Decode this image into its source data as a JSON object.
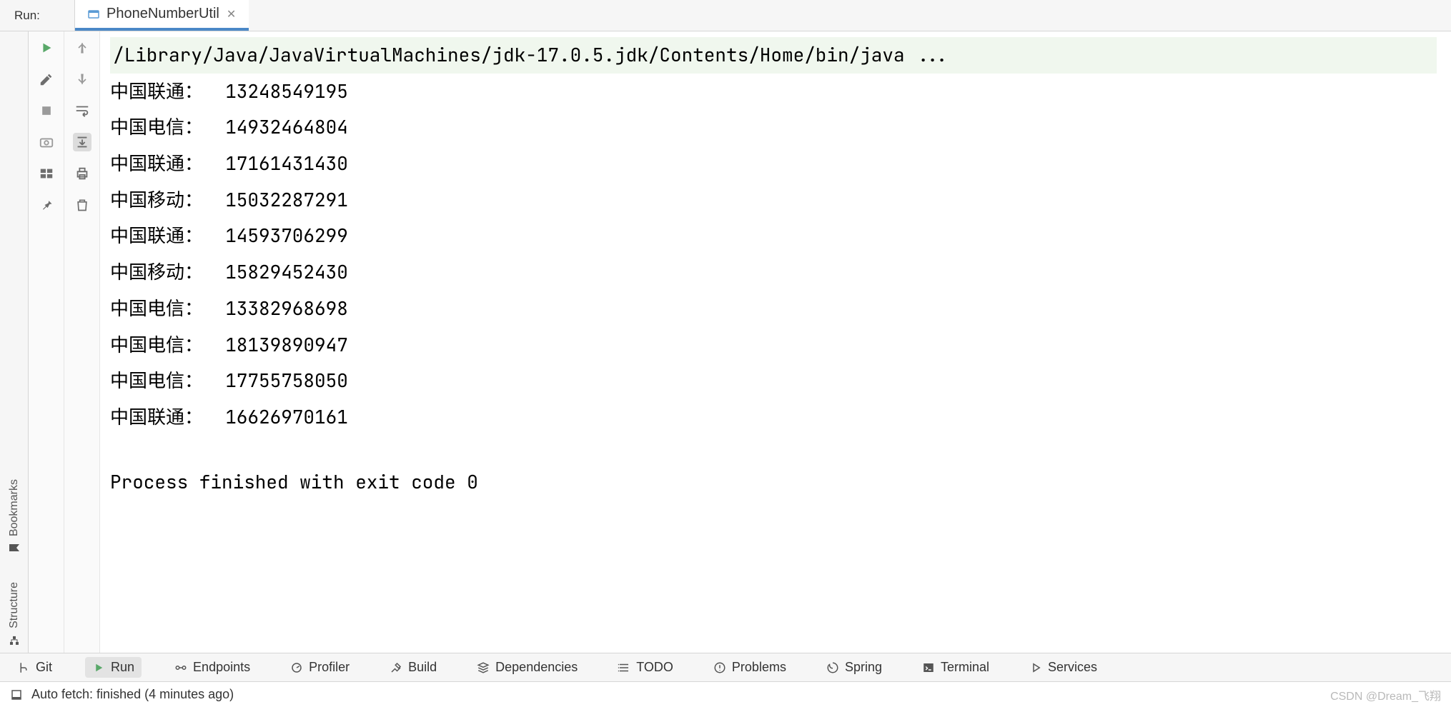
{
  "header": {
    "run_label": "Run:",
    "tab_title": "PhoneNumberUtil"
  },
  "left_rail": {
    "bookmarks_label": "Bookmarks",
    "structure_label": "Structure"
  },
  "console": {
    "command_line": "/Library/Java/JavaVirtualMachines/jdk-17.0.5.jdk/Contents/Home/bin/java ...",
    "lines": [
      {
        "carrier": "中国联通",
        "number": "13248549195"
      },
      {
        "carrier": "中国电信",
        "number": "14932464804"
      },
      {
        "carrier": "中国联通",
        "number": "17161431430"
      },
      {
        "carrier": "中国移动",
        "number": "15032287291"
      },
      {
        "carrier": "中国联通",
        "number": "14593706299"
      },
      {
        "carrier": "中国移动",
        "number": "15829452430"
      },
      {
        "carrier": "中国电信",
        "number": "13382968698"
      },
      {
        "carrier": "中国电信",
        "number": "18139890947"
      },
      {
        "carrier": "中国电信",
        "number": "17755758050"
      },
      {
        "carrier": "中国联通",
        "number": "16626970161"
      }
    ],
    "exit_message": "Process finished with exit code 0"
  },
  "toolbar": {
    "items": [
      {
        "id": "git",
        "label": "Git"
      },
      {
        "id": "run",
        "label": "Run"
      },
      {
        "id": "endpoints",
        "label": "Endpoints"
      },
      {
        "id": "profiler",
        "label": "Profiler"
      },
      {
        "id": "build",
        "label": "Build"
      },
      {
        "id": "dependencies",
        "label": "Dependencies"
      },
      {
        "id": "todo",
        "label": "TODO"
      },
      {
        "id": "problems",
        "label": "Problems"
      },
      {
        "id": "spring",
        "label": "Spring"
      },
      {
        "id": "terminal",
        "label": "Terminal"
      },
      {
        "id": "services",
        "label": "Services"
      }
    ],
    "active_id": "run"
  },
  "statusbar": {
    "message": "Auto fetch: finished (4 minutes ago)",
    "watermark": "CSDN @Dream_飞翔"
  }
}
